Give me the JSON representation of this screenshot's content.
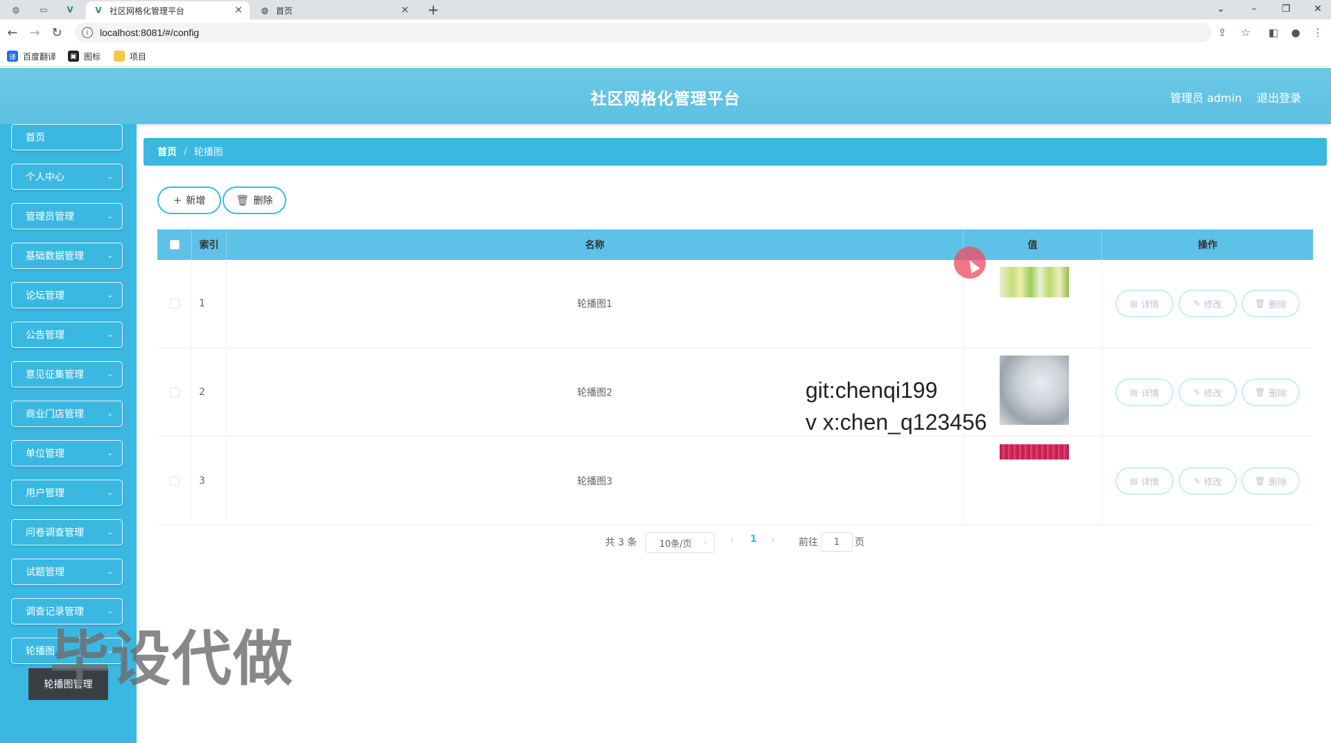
{
  "browser": {
    "tabs": [
      {
        "title": "社区网格化管理平台",
        "active": true
      },
      {
        "title": "首页",
        "active": false
      }
    ],
    "url": "localhost:8081/#/config",
    "bookmarks": [
      {
        "label": "百度翻译",
        "icon": "translate-icon",
        "color": "#1e6fe6"
      },
      {
        "label": "图标",
        "icon": "image-icon",
        "color": "#222222"
      },
      {
        "label": "项目",
        "icon": "folder-icon",
        "color": "#f4c84a"
      }
    ]
  },
  "header": {
    "title": "社区网格化管理平台",
    "user": "管理员 admin",
    "logout": "退出登录"
  },
  "sidebar": {
    "items": [
      {
        "label": "首页",
        "has_children": false
      },
      {
        "label": "个人中心",
        "has_children": true
      },
      {
        "label": "管理员管理",
        "has_children": true
      },
      {
        "label": "基础数据管理",
        "has_children": true
      },
      {
        "label": "论坛管理",
        "has_children": true
      },
      {
        "label": "公告管理",
        "has_children": true
      },
      {
        "label": "意见征集管理",
        "has_children": true
      },
      {
        "label": "商业门店管理",
        "has_children": true
      },
      {
        "label": "单位管理",
        "has_children": true
      },
      {
        "label": "用户管理",
        "has_children": true
      },
      {
        "label": "问卷调查管理",
        "has_children": true
      },
      {
        "label": "试题管理",
        "has_children": true
      },
      {
        "label": "调查记录管理",
        "has_children": true
      },
      {
        "label": "轮播图",
        "has_children": true
      }
    ],
    "submenu_label": "轮播图管理"
  },
  "breadcrumb": {
    "home": "首页",
    "separator": "/",
    "current": "轮播图"
  },
  "actions": {
    "add": "新增",
    "delete": "删除"
  },
  "table": {
    "columns": [
      "索引",
      "名称",
      "值",
      "操作"
    ],
    "rows": [
      {
        "index": "1",
        "name": "轮播图1",
        "thumb": "light-green-flowers"
      },
      {
        "index": "2",
        "name": "轮播图2",
        "thumb": "grey-misty-scene"
      },
      {
        "index": "3",
        "name": "轮播图3",
        "thumb": "red-flower-field"
      }
    ],
    "row_actions": {
      "detail": "详情",
      "edit": "修改",
      "delete": "删除"
    }
  },
  "pagination": {
    "total": "共 3 条",
    "page_size": "10条/页",
    "current_page": "1",
    "goto_prefix": "前往",
    "goto_value": "1",
    "goto_suffix": "页"
  },
  "overlays": {
    "watermark_line1": "git:chenqi199",
    "watermark_line2": "v x:chen_q123456",
    "watermark_big": "毕设代做"
  },
  "colors": {
    "accent": "#3ab8e2",
    "header": "#6cc8e6",
    "table_head": "#5ec1e7"
  }
}
